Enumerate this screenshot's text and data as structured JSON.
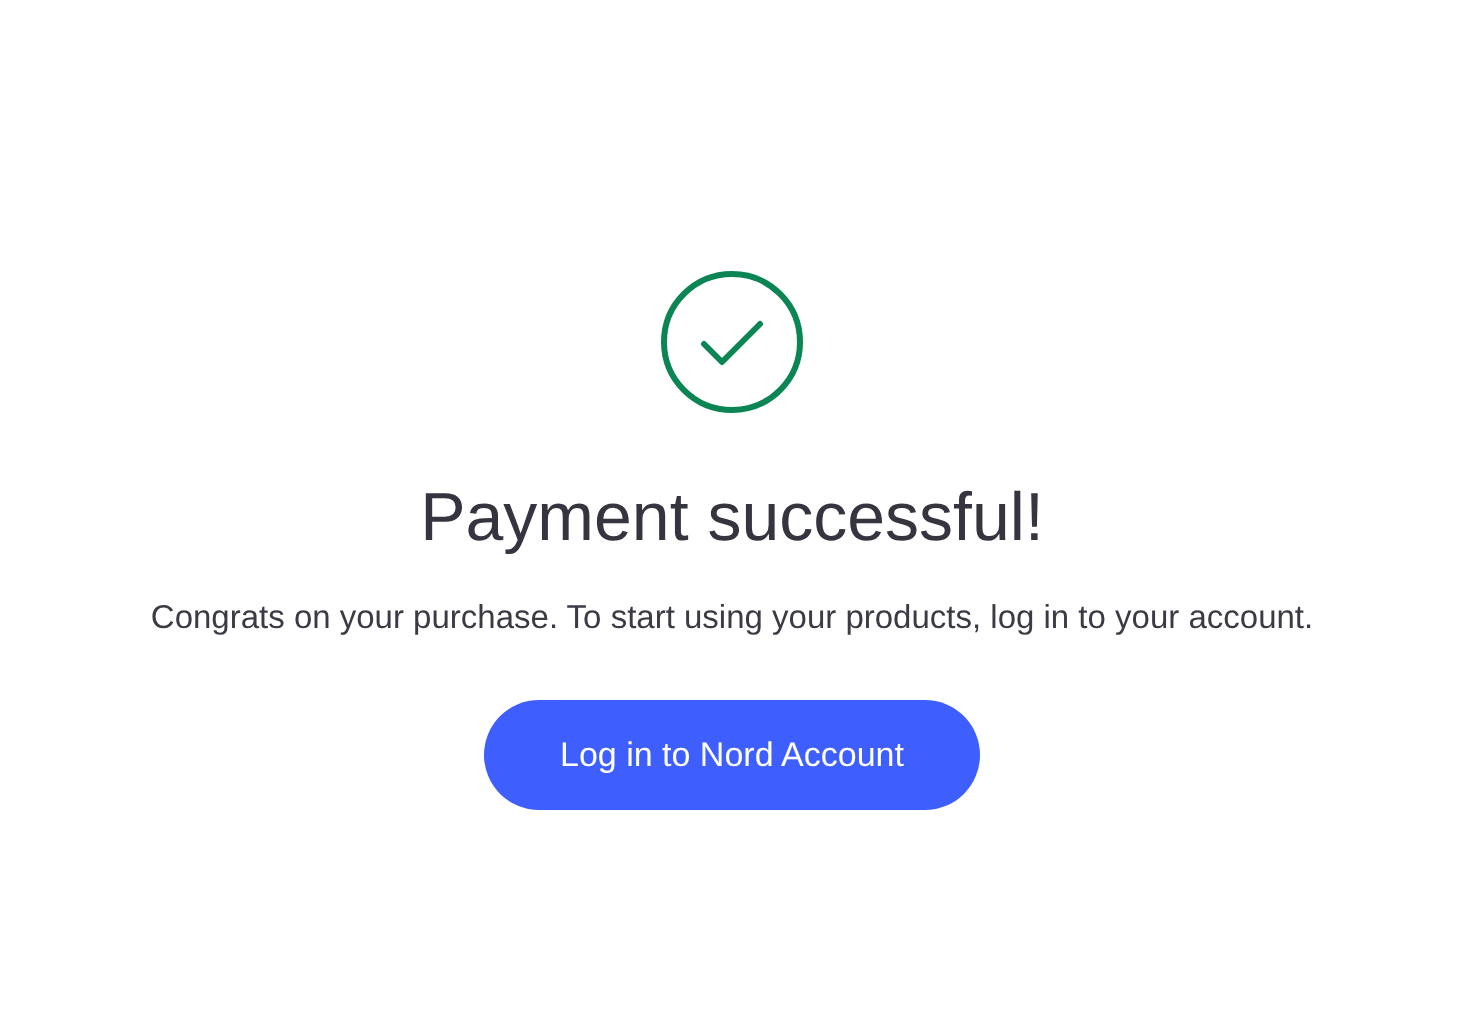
{
  "title": "Payment successful!",
  "message": "Congrats on your purchase. To start using your products, log in to your account.",
  "button": {
    "label": "Log in to Nord Account"
  }
}
